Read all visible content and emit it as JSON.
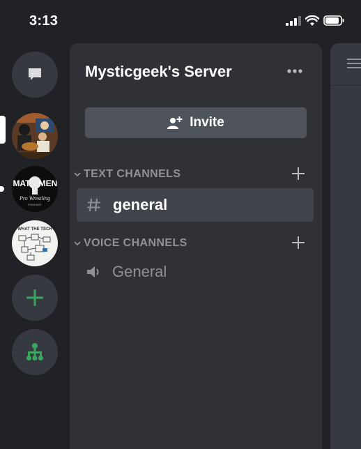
{
  "status": {
    "time": "3:13"
  },
  "server": {
    "name": "Mysticgeek's Server"
  },
  "invite": {
    "label": "Invite"
  },
  "categories": [
    {
      "label": "TEXT CHANNELS",
      "channels": [
        {
          "name": "general",
          "type": "text",
          "active": true
        }
      ]
    },
    {
      "label": "VOICE CHANNELS",
      "channels": [
        {
          "name": "General",
          "type": "voice",
          "active": false
        }
      ]
    }
  ],
  "server_rail": {
    "items": [
      "direct-messages-icon",
      "server-guitar",
      "server-mat-men",
      "server-what-the-tech",
      "add-server-icon",
      "explore-servers-icon"
    ],
    "servers": [
      {
        "name": "Mat Men Pro Wrestling Podcast",
        "logo_text_top": "MAT",
        "logo_text_bottom": "MEN",
        "logo_sub": "Pro Wrestling",
        "logo_sub2": "PODCAST"
      },
      {
        "name": "What The Tech",
        "logo_text": "WHAT THE TECH"
      }
    ]
  },
  "colors": {
    "background": "#202225",
    "panel": "#2f3136",
    "active_channel": "#40444b",
    "button": "#4f545c",
    "muted_text": "#8e9297",
    "green": "#3ba55d"
  }
}
